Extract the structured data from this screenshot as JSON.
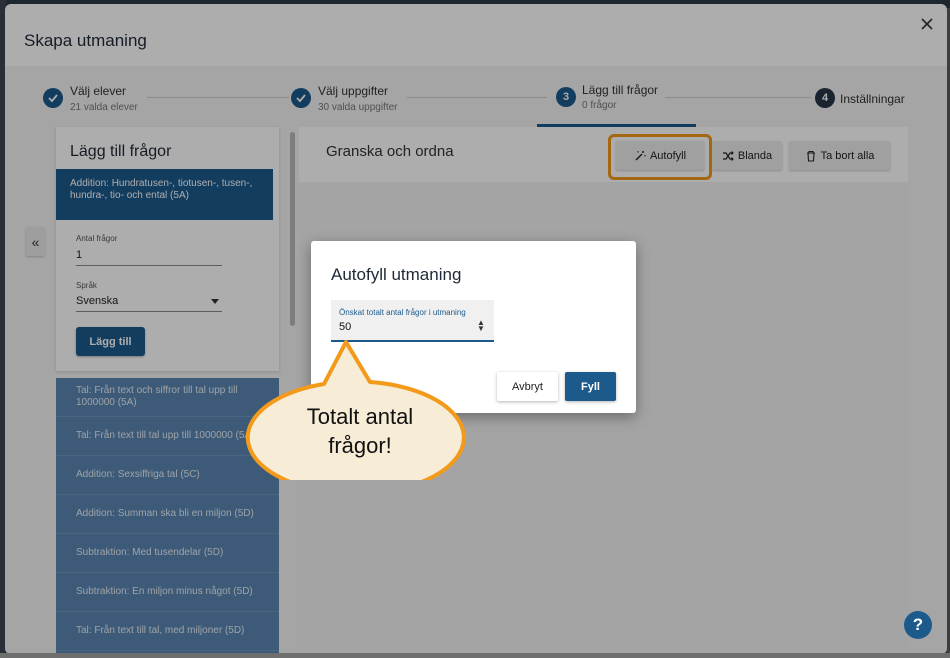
{
  "dialog": {
    "title": "Skapa utmaning"
  },
  "stepper": {
    "steps": [
      {
        "number": "",
        "title": "Välj elever",
        "subtitle": "21 valda elever"
      },
      {
        "number": "",
        "title": "Välj uppgifter",
        "subtitle": "30 valda uppgifter"
      },
      {
        "number": "3",
        "title": "Lägg till frågor",
        "subtitle": "0 frågor"
      },
      {
        "number": "4",
        "title": "Inställningar",
        "subtitle": ""
      }
    ]
  },
  "left_panel": {
    "title": "Lägg till frågor",
    "selected_skill": "Addition: Hundratusen-, tiotusen-, tusen-, hundra-, tio- och ental (5A)",
    "count_label": "Antal frågor",
    "count_value": "1",
    "language_label": "Språk",
    "language_value": "Svenska",
    "add_button": "Lägg till",
    "collapse_glyph": "«"
  },
  "skills": [
    "Tal: Från text och siffror till tal upp till 1000000 (5A)",
    "Tal: Från text till tal upp till 1000000 (5A)",
    "Addition: Sexsiffriga tal (5C)",
    "Addition: Summan ska bli en miljon (5D)",
    "Subtraktion: Med tusendelar (5D)",
    "Subtraktion: En miljon minus något (5D)",
    "Tal: Från text till tal, med miljoner (5D)"
  ],
  "right_panel": {
    "title": "Granska och ordna",
    "autofill_button": "Autofyll",
    "shuffle_button": "Blanda",
    "remove_all_button": "Ta bort alla"
  },
  "modal": {
    "title": "Autofyll utmaning",
    "input_label": "Önskat totalt antal frågor i utmaning",
    "input_value": "50",
    "cancel_button": "Avbryt",
    "fill_button": "Fyll"
  },
  "callout": {
    "line1": "Totalt antal",
    "line2": "frågor!"
  },
  "help": {
    "glyph": "?"
  },
  "colors": {
    "primary": "#1d5a8c",
    "highlight": "#f39a1b",
    "callout_fill": "#f7ecd6"
  }
}
